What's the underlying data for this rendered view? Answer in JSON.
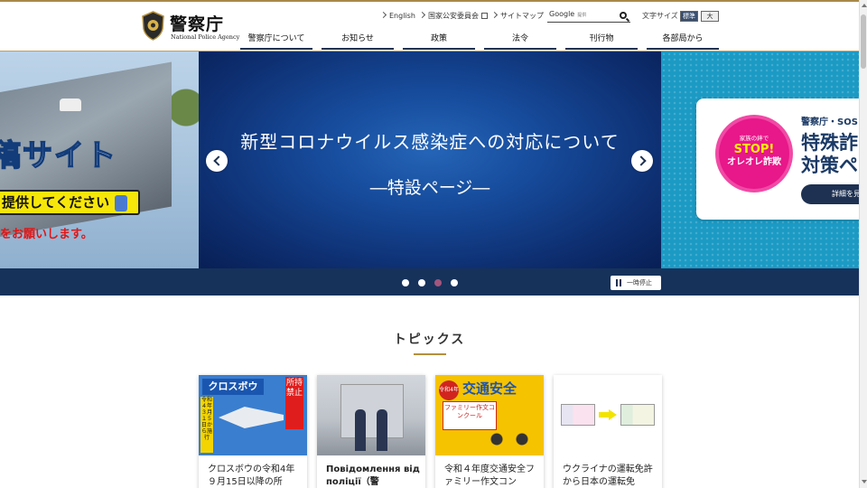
{
  "header": {
    "logo_title": "警察庁",
    "logo_subtitle": "National Police Agency",
    "util_links": [
      "English",
      "国家公安委員会",
      "サイトマップ"
    ],
    "search": {
      "brand": "Google",
      "hint": "提供"
    },
    "fontsize_label": "文字サイズ",
    "fontsize_std": "標準",
    "fontsize_large": "大"
  },
  "nav": [
    "警察庁について",
    "お知らせ",
    "政策",
    "法令",
    "刊行物",
    "各部局から"
  ],
  "hero": {
    "left_slide": {
      "big_text": "稿サイト",
      "yellow_text": "提供してください",
      "red_text": "をお願いします。"
    },
    "main_slide": {
      "title": "新型コロナウイルス感染症への対応について",
      "subtitle": "―特設ページ―"
    },
    "right_slide": {
      "heading_small": "警察庁・SOS",
      "heading_line1": "特殊詐",
      "heading_line2": "対策ペ",
      "badge_top": "家族の絆で",
      "badge_stop": "STOP!",
      "badge_bottom": "オレオレ詐欺",
      "button": "詳細を見"
    },
    "pause_label": "一時停止",
    "dots": 4,
    "active_dot": 3
  },
  "topics": {
    "title": "トピックス",
    "cards": [
      {
        "caption": "クロスボウの令和4年９月15日以降の所",
        "image_banner": "クロスボウ",
        "image_forbid": "所持禁止",
        "image_side": "令和４年３月１５日から施行"
      },
      {
        "caption": "Повідомлення від поліції（警"
      },
      {
        "caption": "令和４年度交通安全ファミリー作文コン",
        "image_title": "交通安全",
        "image_circle": "令和4年度",
        "image_sub": "ファミリー作文コンクール"
      },
      {
        "caption": "ウクライナの運転免許から日本の運転免"
      }
    ]
  },
  "colors": {
    "navy": "#1e3152",
    "gold": "#b58f3c",
    "hero_blue": "#164a9a",
    "right_slide_bg": "#1b9ac4",
    "stop_pink": "#e8178a"
  },
  "icons": [
    "emblem-icon",
    "external-link-icon",
    "search-icon",
    "prev-arrow-icon",
    "next-arrow-icon",
    "pause-icon"
  ]
}
